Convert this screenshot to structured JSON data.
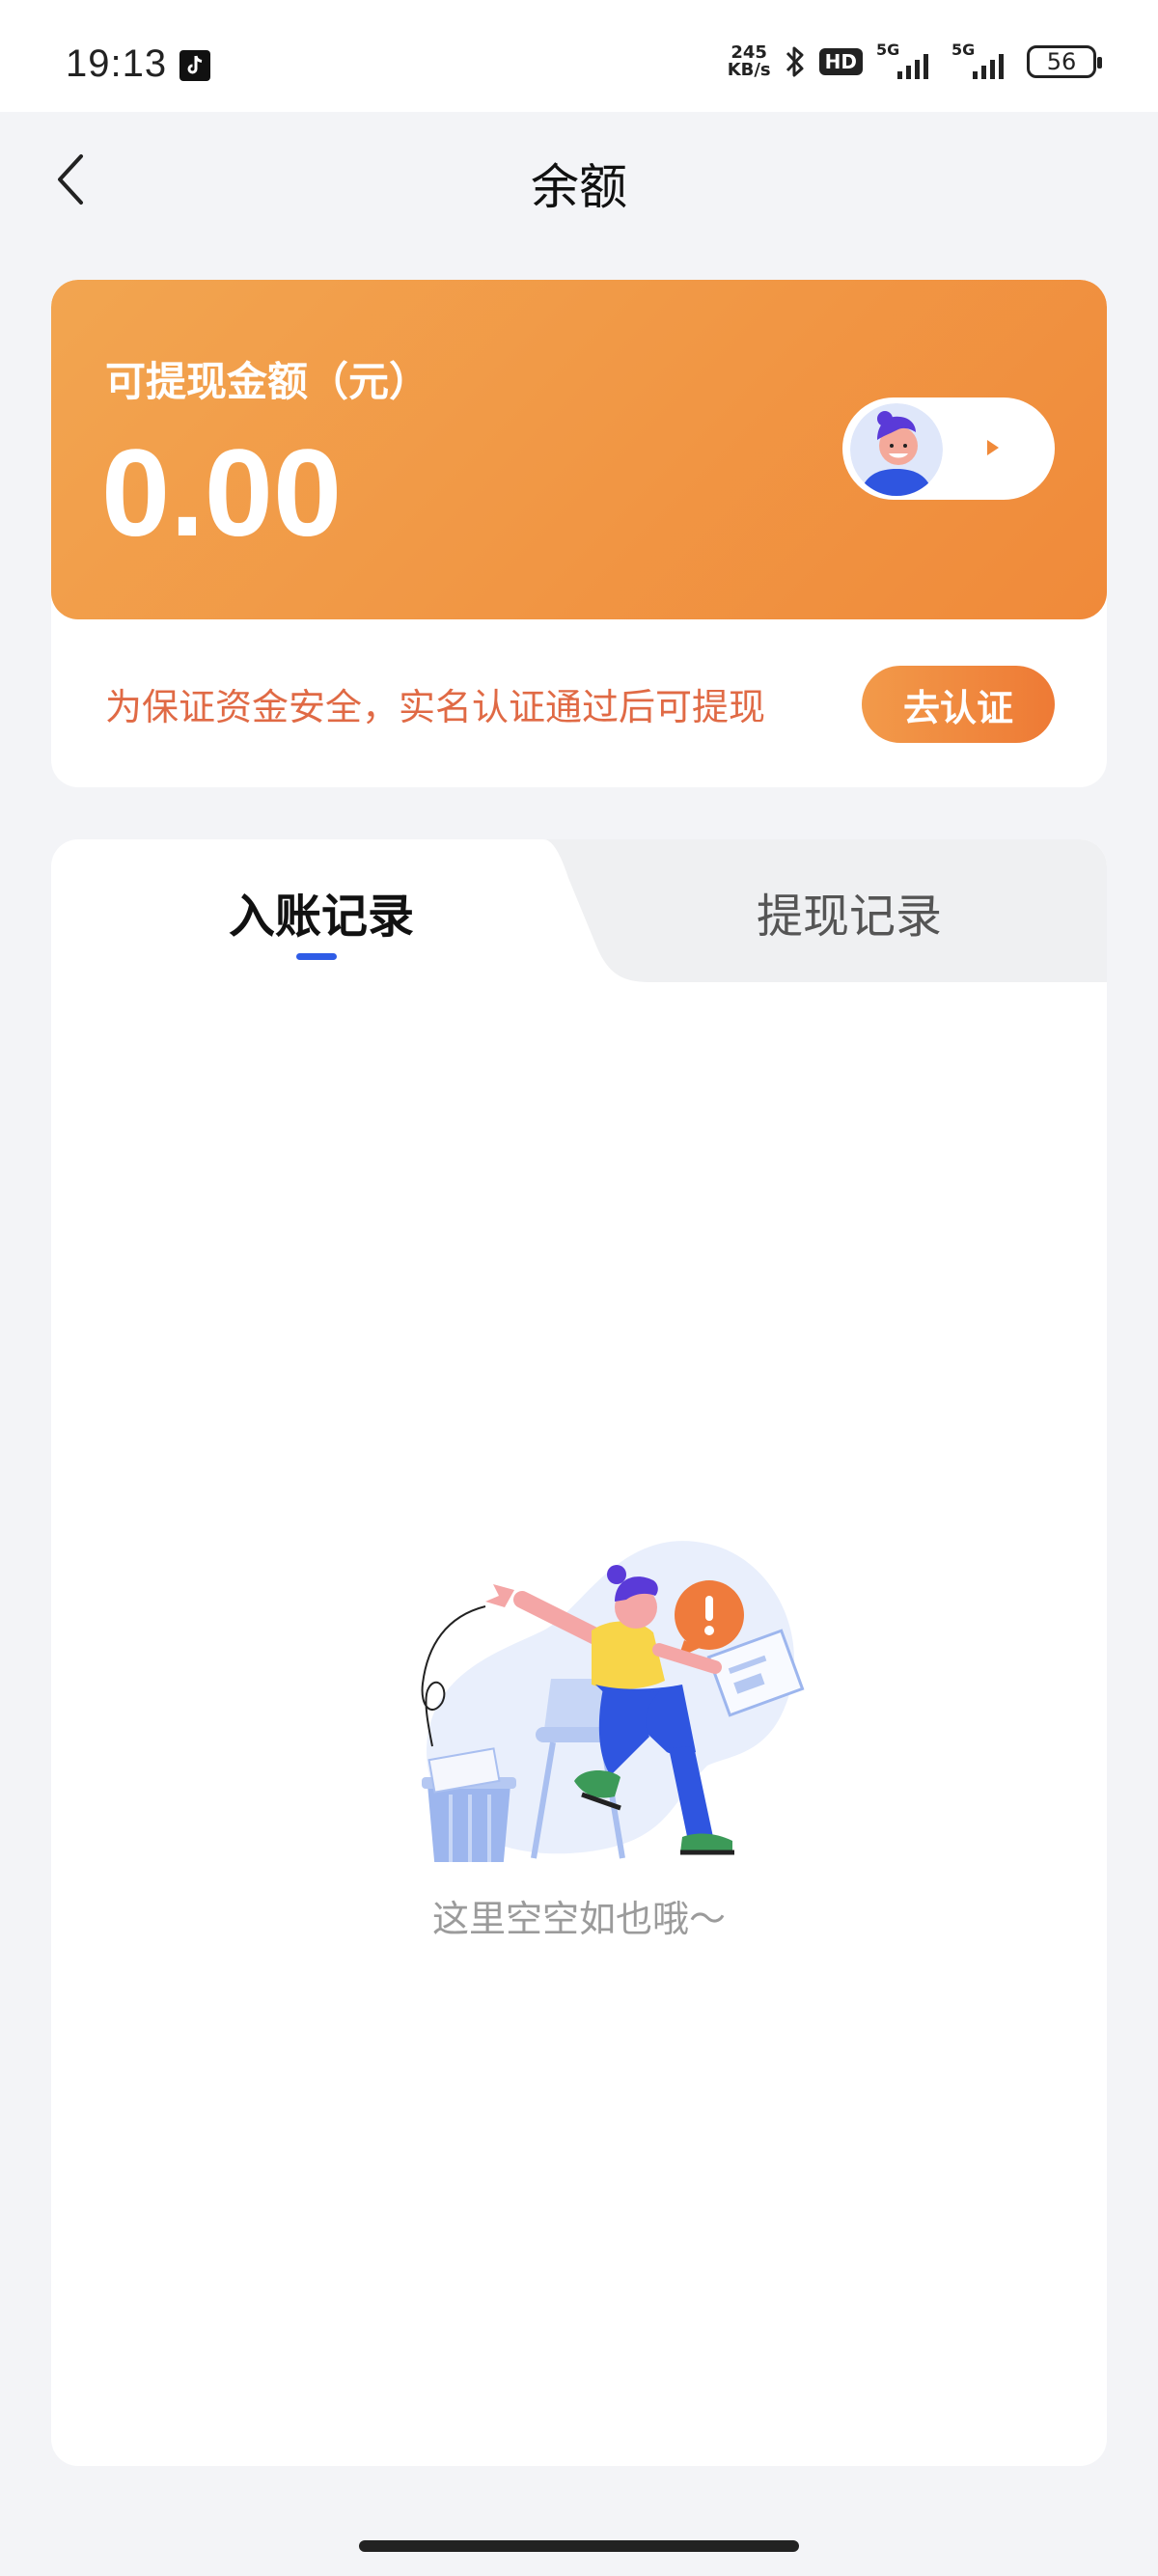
{
  "status_bar": {
    "time": "19:13",
    "speed_value": "245",
    "speed_unit": "KB/s",
    "hd_label": "HD",
    "net1": "5G",
    "net2": "5G",
    "battery": "56",
    "icons": [
      "tiktok-icon",
      "bluetooth-icon",
      "signal-icon",
      "battery-icon"
    ]
  },
  "nav": {
    "title": "余额",
    "back_icon": "chevron-left-icon"
  },
  "balance": {
    "label": "可提现金额（元）",
    "amount": "0.00",
    "notice": "为保证资金安全，实名认证通过后可提现",
    "verify_button": "去认证",
    "colors": {
      "card_start": "#f2a550",
      "card_end": "#f08a3a",
      "notice": "#e06a45"
    }
  },
  "records": {
    "tabs": [
      {
        "label": "入账记录",
        "active": true
      },
      {
        "label": "提现记录",
        "active": false
      }
    ],
    "empty_text": "这里空空如也哦～",
    "accent": "#2f5ce6"
  }
}
